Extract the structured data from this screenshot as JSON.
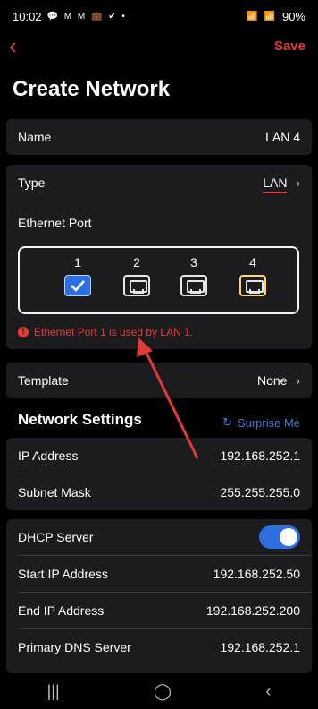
{
  "status": {
    "time": "10:02",
    "left_icons": "💬 M M 💼 ✔ •",
    "right_icons": "📶 📶",
    "battery": "90%"
  },
  "topbar": {
    "back_icon": "chevron-left-icon",
    "save_label": "Save"
  },
  "page": {
    "title": "Create Network"
  },
  "name_row": {
    "label": "Name",
    "value": "LAN 4"
  },
  "type_row": {
    "label": "Type",
    "value": "LAN"
  },
  "ethernet": {
    "label": "Ethernet Port",
    "ports": [
      {
        "num": "1",
        "state": "checked"
      },
      {
        "num": "2",
        "state": "unchecked"
      },
      {
        "num": "3",
        "state": "unchecked"
      },
      {
        "num": "4",
        "state": "selected"
      }
    ],
    "warning": "Ethernet Port 1 is used by LAN 1."
  },
  "template_row": {
    "label": "Template",
    "value": "None"
  },
  "network_settings": {
    "title": "Network Settings",
    "surprise": "Surprise Me",
    "rows": [
      {
        "label": "IP Address",
        "value": "192.168.252.1"
      },
      {
        "label": "Subnet Mask",
        "value": "255.255.255.0"
      }
    ]
  },
  "dhcp": {
    "label": "DHCP Server",
    "enabled": true,
    "rows": [
      {
        "label": "Start IP Address",
        "value": "192.168.252.50"
      },
      {
        "label": "End IP Address",
        "value": "192.168.252.200"
      },
      {
        "label": "Primary DNS Server",
        "value": "192.168.252.1"
      }
    ]
  },
  "colors": {
    "accent": "#e43b3b",
    "blue": "#2d6fe0",
    "card": "#1c1c1e"
  }
}
